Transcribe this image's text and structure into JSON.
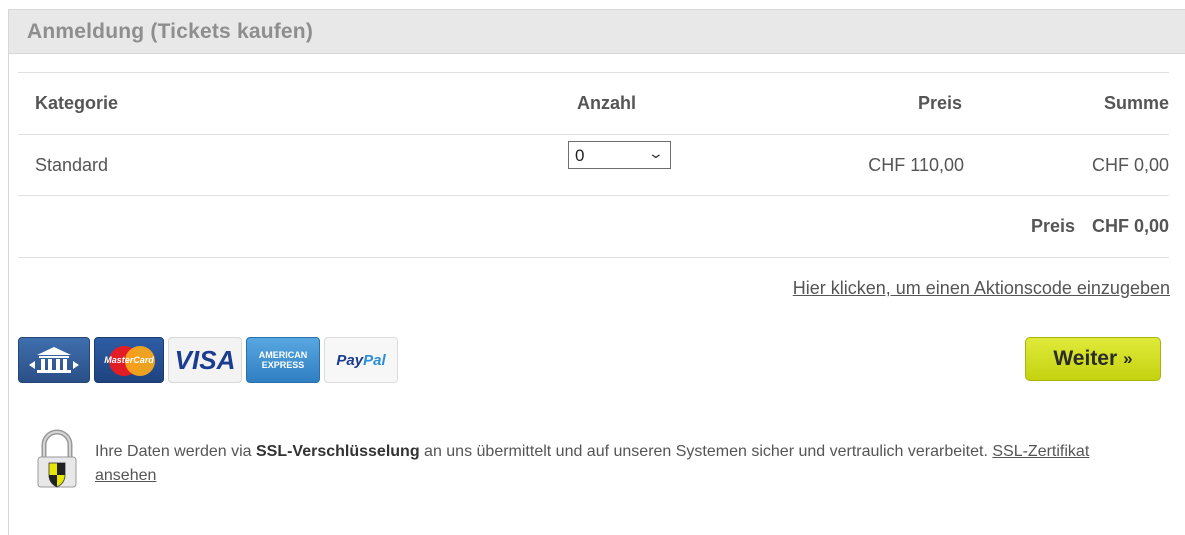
{
  "panel": {
    "title": "Anmeldung (Tickets kaufen)"
  },
  "table": {
    "headers": {
      "category": "Kategorie",
      "quantity": "Anzahl",
      "price": "Preis",
      "sum": "Summe"
    },
    "row": {
      "category": "Standard",
      "quantity": "0",
      "price": "CHF 110,00",
      "sum": "CHF 0,00"
    },
    "total_label": "Preis",
    "total_value": "CHF 0,00"
  },
  "promo_link": "Hier klicken, um einen Aktionscode einzugeben",
  "payment": {
    "icons": [
      "bank-transfer-icon",
      "mastercard-icon",
      "visa-icon",
      "american-express-icon",
      "paypal-icon"
    ],
    "mastercard_label": "MasterCard",
    "visa_label": "VISA",
    "amex_line1": "AMERICAN",
    "amex_line2": "EXPRESS",
    "paypal_pay": "Pay",
    "paypal_pal": "Pal"
  },
  "button": {
    "weiter_label": "Weiter",
    "weiter_arrow": "»"
  },
  "ssl": {
    "text_before": "Ihre Daten werden via ",
    "text_bold": "SSL-Verschlüsselung",
    "text_after": " an uns übermittelt und auf unseren Systemen sicher und vertraulich verarbeitet. ",
    "link": "SSL-Zertifikat ansehen"
  },
  "colors": {
    "button": "#cfdc1a",
    "header_bg": "#e8e8e8"
  }
}
